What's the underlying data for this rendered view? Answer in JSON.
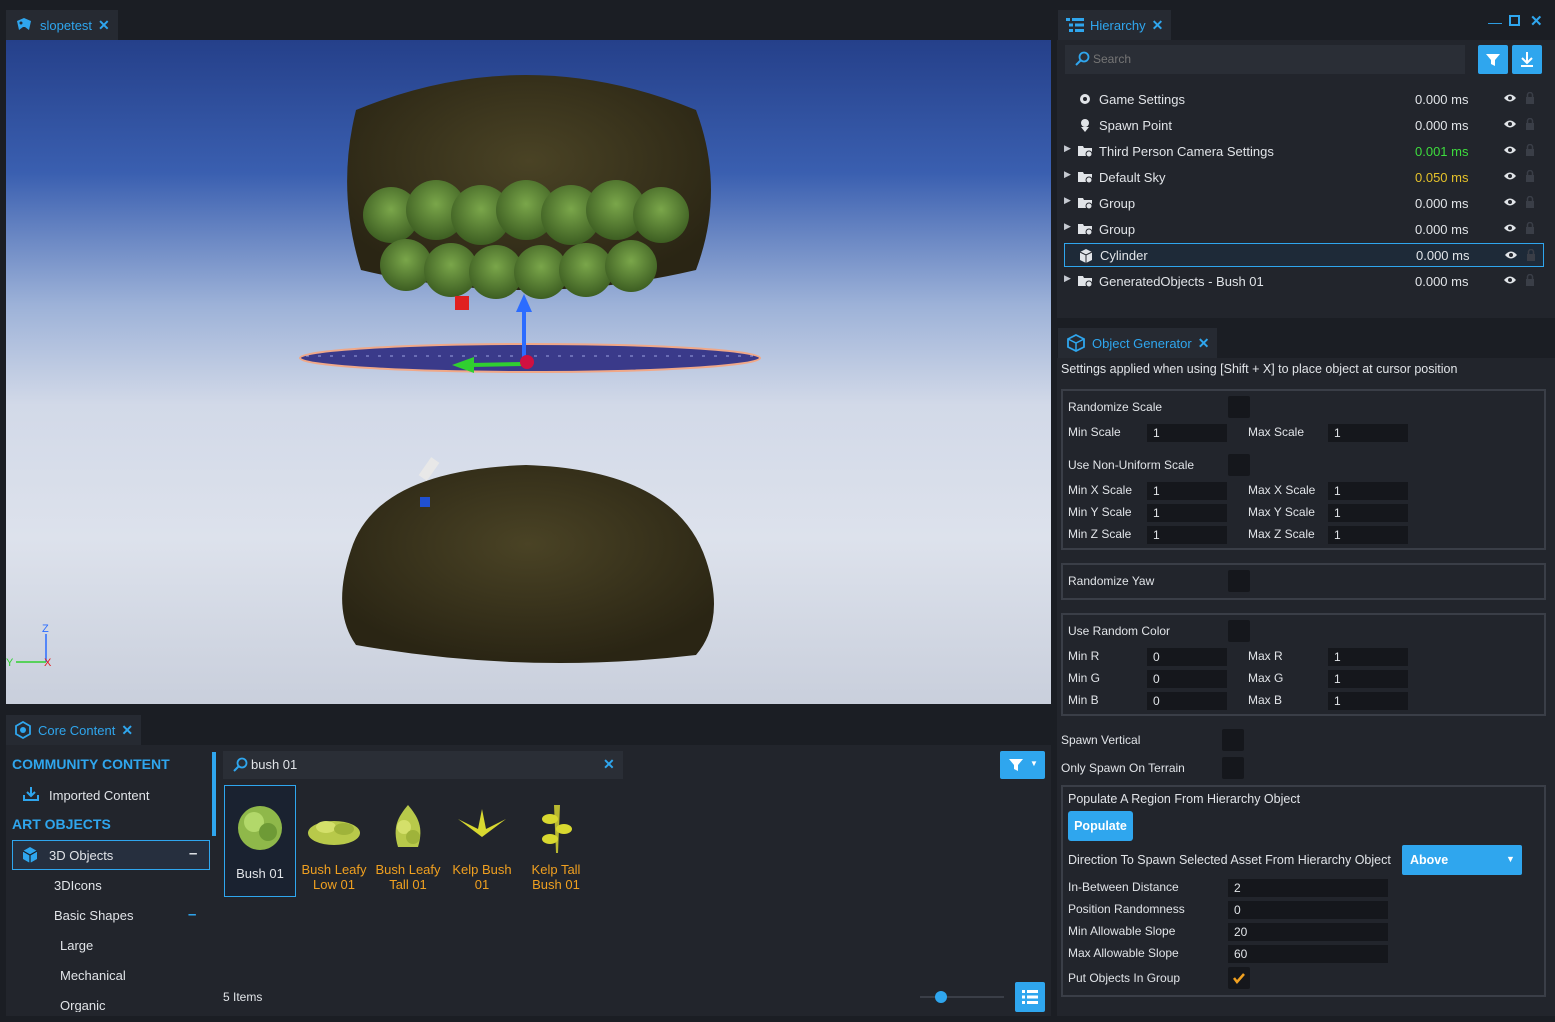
{
  "viewport_tab": {
    "label": "slopetest"
  },
  "gizmo_axes": {
    "z": "Z",
    "y": "Y",
    "x": "X"
  },
  "hierarchy": {
    "tab_label": "Hierarchy",
    "search_placeholder": "Search",
    "items": [
      {
        "name": "Game Settings",
        "ms": "0.000 ms",
        "ms_color": "#e1e4e8",
        "expandable": false,
        "icon": "settings-icon"
      },
      {
        "name": "Spawn Point",
        "ms": "0.000 ms",
        "ms_color": "#e1e4e8",
        "expandable": false,
        "icon": "spawn-point-icon"
      },
      {
        "name": "Third Person Camera Settings",
        "ms": "0.001 ms",
        "ms_color": "#3ddc3d",
        "expandable": true,
        "icon": "folder-settings-icon"
      },
      {
        "name": "Default Sky",
        "ms": "0.050 ms",
        "ms_color": "#e5c22a",
        "expandable": true,
        "icon": "folder-settings-icon"
      },
      {
        "name": "Group",
        "ms": "0.000 ms",
        "ms_color": "#e1e4e8",
        "expandable": true,
        "icon": "folder-settings-icon"
      },
      {
        "name": "Group",
        "ms": "0.000 ms",
        "ms_color": "#e1e4e8",
        "expandable": true,
        "icon": "folder-settings-icon"
      },
      {
        "name": "Cylinder",
        "ms": "0.000 ms",
        "ms_color": "#e1e4e8",
        "expandable": false,
        "icon": "cube-icon",
        "selected": true
      },
      {
        "name": "GeneratedObjects - Bush 01",
        "ms": "0.000 ms",
        "ms_color": "#e1e4e8",
        "expandable": true,
        "icon": "folder-settings-icon"
      }
    ]
  },
  "object_generator": {
    "tab_label": "Object Generator",
    "description": "Settings applied when using [Shift + X] to place object at cursor position",
    "randomize_scale": "Randomize Scale",
    "min_scale_label": "Min Scale",
    "min_scale": "1",
    "max_scale_label": "Max Scale",
    "max_scale": "1",
    "non_uniform": "Use Non-Uniform Scale",
    "min_x_label": "Min X Scale",
    "min_x": "1",
    "max_x_label": "Max X Scale",
    "max_x": "1",
    "min_y_label": "Min Y Scale",
    "min_y": "1",
    "max_y_label": "Max Y Scale",
    "max_y": "1",
    "min_z_label": "Min Z Scale",
    "min_z": "1",
    "max_z_label": "Max Z Scale",
    "max_z": "1",
    "randomize_yaw": "Randomize Yaw",
    "random_color": "Use Random Color",
    "min_r_label": "Min R",
    "min_r": "0",
    "max_r_label": "Max R",
    "max_r": "1",
    "min_g_label": "Min G",
    "min_g": "0",
    "max_g_label": "Max G",
    "max_g": "1",
    "min_b_label": "Min B",
    "min_b": "0",
    "max_b_label": "Max B",
    "max_b": "1",
    "spawn_vertical": "Spawn Vertical",
    "only_terrain": "Only Spawn On Terrain",
    "populate_title": "Populate A Region From Hierarchy Object",
    "populate_button": "Populate",
    "direction_label": "Direction To Spawn Selected Asset From Hierarchy Object",
    "direction_value": "Above",
    "between_label": "In-Between Distance",
    "between": "2",
    "randomness_label": "Position Randomness",
    "randomness": "0",
    "min_slope_label": "Min Allowable Slope",
    "min_slope": "20",
    "max_slope_label": "Max Allowable Slope",
    "max_slope": "60",
    "group_label": "Put Objects In Group",
    "group_checked": true
  },
  "core_content": {
    "tab_label": "Core Content",
    "community_header": "COMMUNITY CONTENT",
    "imported": "Imported Content",
    "art_header": "ART OBJECTS",
    "objects_3d": "3D Objects",
    "icons_3d": "3DIcons",
    "basic_shapes": "Basic Shapes",
    "large": "Large",
    "mechanical": "Mechanical",
    "organic": "Organic",
    "search_value": "bush 01",
    "items_count": "5 Items",
    "zoom_level": 0.25,
    "tiles": [
      {
        "line1": "Bush 01",
        "line2": "",
        "selected": true
      },
      {
        "line1": "Bush Leafy",
        "line2": "Low 01",
        "selected": false
      },
      {
        "line1": "Bush Leafy",
        "line2": "Tall 01",
        "selected": false
      },
      {
        "line1": "Kelp Bush",
        "line2": "01",
        "selected": false
      },
      {
        "line1": "Kelp Tall",
        "line2": "Bush 01",
        "selected": false
      }
    ]
  }
}
